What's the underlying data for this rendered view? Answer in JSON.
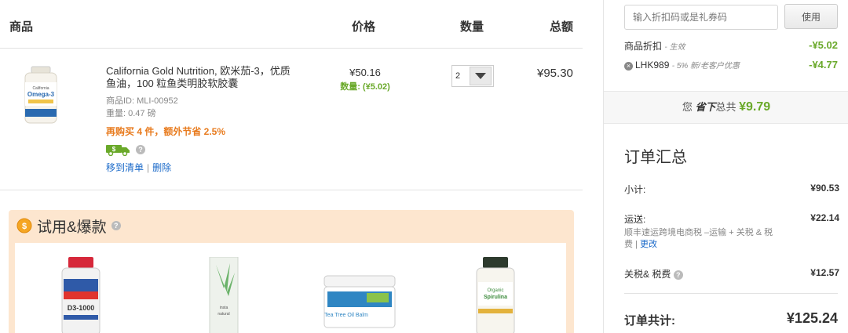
{
  "table_header": {
    "product": "商品",
    "price": "价格",
    "quantity": "数量",
    "total": "总额"
  },
  "item": {
    "title": "California Gold Nutrition, 欧米茄-3，优质鱼油，100 粒鱼类明胶软胶囊",
    "product_id": "商品ID: MLI-00952",
    "weight": "重量: 0.47 磅",
    "promo": "再购买 4 件，额外节省 2.5%",
    "move_to_list": "移到清单",
    "separator": "|",
    "delete": "删除",
    "price": "¥50.16",
    "savings": "数量: (¥5.02)",
    "quantity": "2",
    "total": "¥95.30",
    "bottle_label": "Omega-3"
  },
  "trial_section": {
    "title": "试用&爆款",
    "products": [
      {
        "name": "21st Century D3-1000 IU",
        "icon": "vitamin-d-bottle-icon"
      },
      {
        "name": "Insta Natural Retinol Serum",
        "icon": "retinol-serum-icon"
      },
      {
        "name": "Earth's Care Tea Tree Oil Balm",
        "icon": "tea-tree-balm-icon"
      },
      {
        "name": "California Gold Nutrition Organic Spirulina",
        "icon": "spirulina-bottle-icon"
      }
    ]
  },
  "coupon": {
    "placeholder": "输入折扣码或是礼券码",
    "apply": "使用"
  },
  "discounts": [
    {
      "label": "商品折扣",
      "sub": "- 生效",
      "amount": "-¥5.02"
    },
    {
      "label": "LHK989",
      "sub": "- 5% 新/老客户优惠",
      "amount": "-¥4.77"
    }
  ],
  "savings_band": {
    "prefix": "您",
    "emph": "省下",
    "mid": "总共",
    "amount": "¥9.79"
  },
  "summary": {
    "title": "订单汇总",
    "subtotal_label": "小计:",
    "subtotal": "¥90.53",
    "shipping_label": "运送:",
    "shipping": "¥22.14",
    "shipping_note": "顺丰速运跨境电商税 –运输 + 关税 & 税费",
    "shipping_change": "更改",
    "tax_label": "关税& 税费",
    "tax": "¥12.57",
    "grand_label": "订单共计:",
    "grand": "¥125.24"
  },
  "colors": {
    "green": "#6aa92a",
    "orange": "#e87b1e",
    "link": "#1b6ac9",
    "trial_bg": "#fde6cf"
  }
}
